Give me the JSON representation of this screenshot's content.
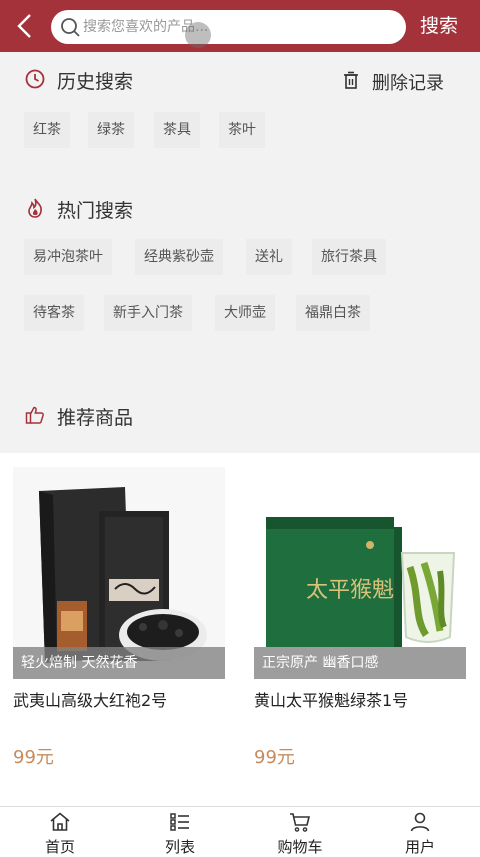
{
  "header": {
    "search_placeholder": "搜索您喜欢的产品...",
    "search_button": "搜索",
    "accent_color": "#a3323a"
  },
  "history": {
    "title": "历史搜索",
    "icon": "clock-icon",
    "delete_label": "删除记录",
    "tags": [
      "红茶",
      "绿茶",
      "茶具",
      "茶叶"
    ]
  },
  "hot": {
    "title": "热门搜索",
    "icon": "flame-icon",
    "tags": [
      "易冲泡茶叶",
      "经典紫砂壶",
      "送礼",
      "旅行茶具",
      "待客茶",
      "新手入门茶",
      "大师壶",
      "福鼎白茶"
    ]
  },
  "recommend": {
    "title": "推荐商品",
    "icon": "thumbs-up-icon",
    "products": [
      {
        "caption": "轻火焙制 天然花香",
        "name": "武夷山高级大红袍2号",
        "price": "99元"
      },
      {
        "caption": "正宗原产 幽香口感",
        "name": "黄山太平猴魁绿茶1号",
        "price": "99元"
      }
    ],
    "package_text": "太平猴魁",
    "price_color": "#c98a5b"
  },
  "tabbar": [
    {
      "label": "首页",
      "icon": "home-icon"
    },
    {
      "label": "列表",
      "icon": "list-icon"
    },
    {
      "label": "购物车",
      "icon": "cart-icon"
    },
    {
      "label": "用户",
      "icon": "user-icon"
    }
  ]
}
